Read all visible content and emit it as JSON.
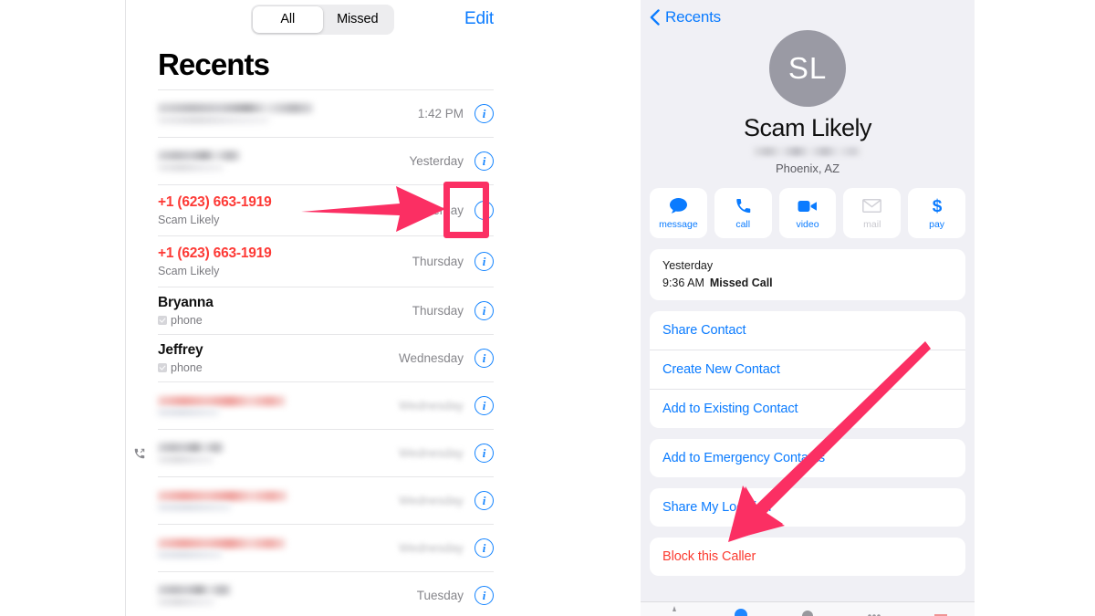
{
  "left_screen": {
    "segmented": {
      "options": [
        "All",
        "Missed"
      ],
      "selected": "All"
    },
    "edit_label": "Edit",
    "title": "Recents",
    "rows": [
      {
        "name": "",
        "sub": "",
        "time": "1:42 PM",
        "redacted": "gray",
        "time_blurred": false,
        "outgoing": false,
        "info_icon": "info-icon"
      },
      {
        "name": "",
        "sub": "",
        "time": "Yesterday",
        "redacted": "gray",
        "time_blurred": false,
        "outgoing": false,
        "info_icon": "info-icon"
      },
      {
        "name": "+1 (623) 663-1919",
        "sub": "Scam Likely",
        "time": "Yesterday",
        "redacted": "none",
        "time_blurred": false,
        "outgoing": false,
        "info_icon": "info-icon"
      },
      {
        "name": "+1 (623) 663-1919",
        "sub": "Scam Likely",
        "time": "Thursday",
        "redacted": "none",
        "time_blurred": false,
        "outgoing": false,
        "info_icon": "info-icon"
      },
      {
        "name": "Bryanna",
        "sub": "phone",
        "time": "Thursday",
        "redacted": "none",
        "time_blurred": false,
        "outgoing": false,
        "info_icon": "info-icon"
      },
      {
        "name": "Jeffrey",
        "sub": "phone",
        "time": "Wednesday",
        "redacted": "none",
        "time_blurred": false,
        "outgoing": false,
        "info_icon": "info-icon"
      },
      {
        "name": "",
        "sub": "",
        "time": "Wednesday",
        "redacted": "red",
        "time_blurred": true,
        "outgoing": false,
        "info_icon": "info-icon"
      },
      {
        "name": "",
        "sub": "",
        "time": "Wednesday",
        "redacted": "gray",
        "time_blurred": true,
        "outgoing": true,
        "info_icon": "info-icon"
      },
      {
        "name": "",
        "sub": "",
        "time": "Wednesday",
        "redacted": "red",
        "time_blurred": true,
        "outgoing": false,
        "info_icon": "info-icon"
      },
      {
        "name": "",
        "sub": "",
        "time": "Wednesday",
        "redacted": "red",
        "time_blurred": true,
        "outgoing": false,
        "info_icon": "info-icon"
      },
      {
        "name": "",
        "sub": "",
        "time": "Tuesday",
        "redacted": "gray",
        "time_blurred": false,
        "outgoing": false,
        "info_icon": "info-icon"
      }
    ]
  },
  "right_screen": {
    "back_label": "Recents",
    "avatar_initials": "SL",
    "contact_name": "Scam Likely",
    "contact_location": "Phoenix, AZ",
    "actions": [
      {
        "label": "message",
        "icon": "message-bubble-icon",
        "enabled": true
      },
      {
        "label": "call",
        "icon": "phone-handset-icon",
        "enabled": true
      },
      {
        "label": "video",
        "icon": "video-camera-icon",
        "enabled": true
      },
      {
        "label": "mail",
        "icon": "envelope-icon",
        "enabled": false
      },
      {
        "label": "pay",
        "icon": "dollar-sign-icon",
        "enabled": true
      }
    ],
    "call_entry": {
      "day": "Yesterday",
      "time": "9:36 AM",
      "type": "Missed Call"
    },
    "menu_group_1": [
      "Share Contact",
      "Create New Contact",
      "Add to Existing Contact"
    ],
    "menu_group_2": [
      "Add to Emergency Contacts"
    ],
    "menu_group_3": [
      "Share My Location"
    ],
    "menu_group_4": [
      "Block this Caller"
    ]
  },
  "annotations": {
    "highlight_color": "#fb2f63",
    "arrow_color": "#fb2f63",
    "left_arrow_target": "info-icon of Scam Likely row",
    "right_arrow_target": "Block this Caller"
  }
}
